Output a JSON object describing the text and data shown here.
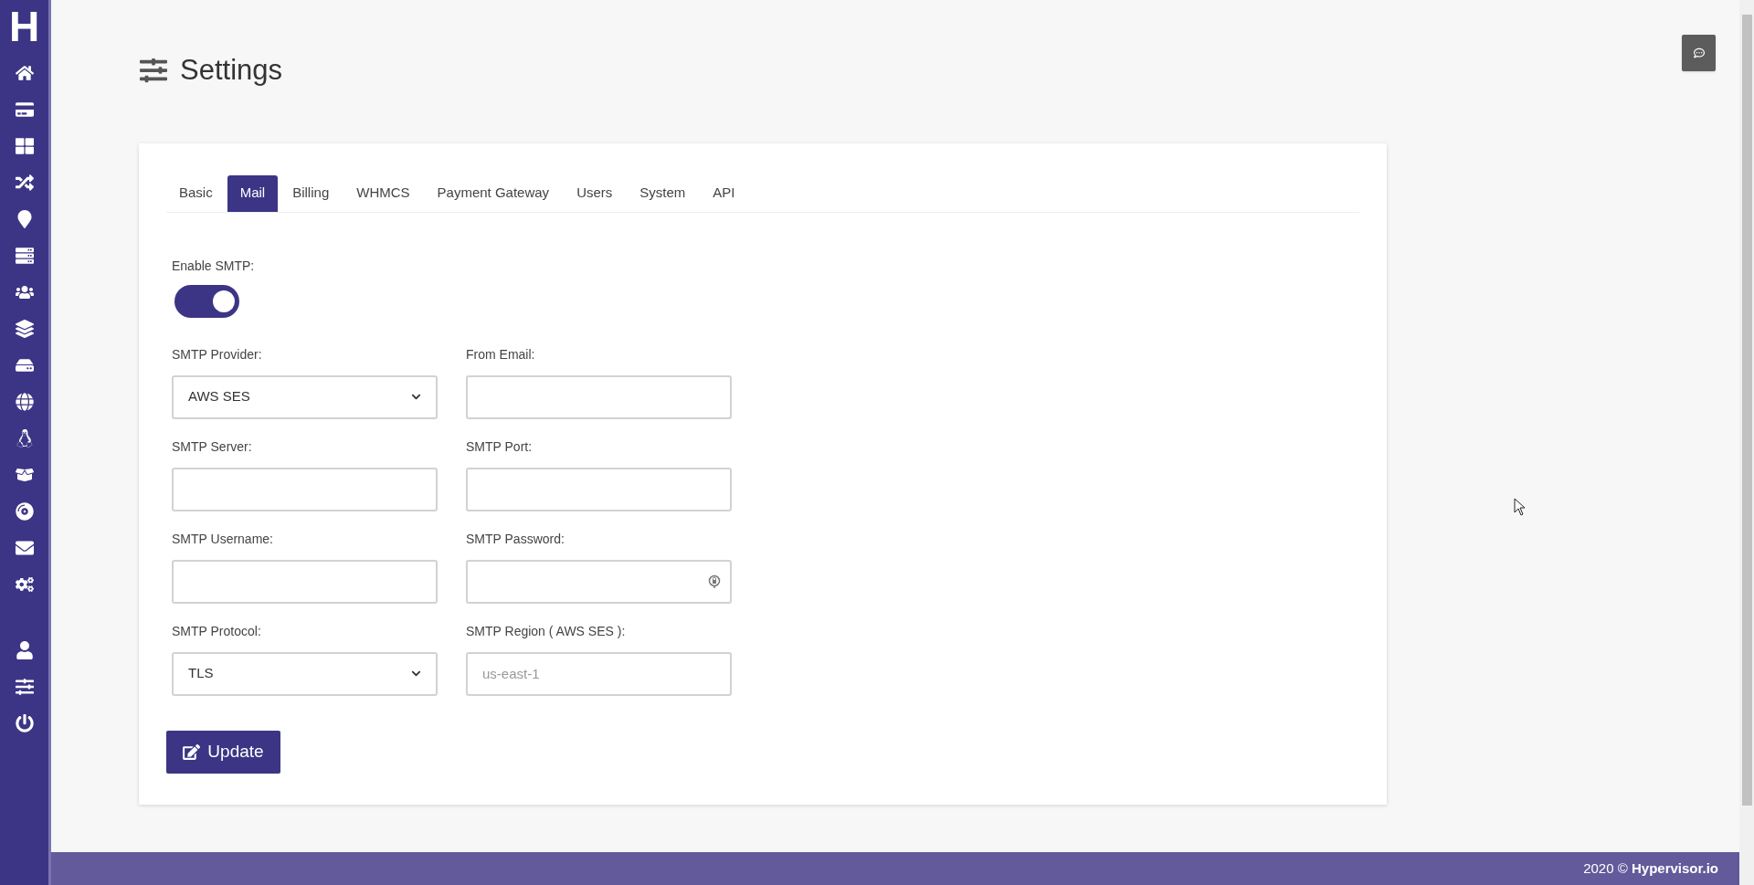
{
  "logo": "H",
  "page": {
    "title": "Settings"
  },
  "tabs": [
    {
      "label": "Basic",
      "selected": false
    },
    {
      "label": "Mail",
      "selected": true
    },
    {
      "label": "Billing",
      "selected": false
    },
    {
      "label": "WHMCS",
      "selected": false
    },
    {
      "label": "Payment Gateway",
      "selected": false
    },
    {
      "label": "Users",
      "selected": false
    },
    {
      "label": "System",
      "selected": false
    },
    {
      "label": "API",
      "selected": false
    }
  ],
  "enable_smtp": {
    "label": "Enable SMTP:",
    "on": true
  },
  "fields": [
    {
      "kind": "select",
      "label": "SMTP Provider:",
      "value": "AWS SES"
    },
    {
      "kind": "text",
      "label": "From Email:"
    },
    {
      "kind": "text",
      "label": "SMTP Server:"
    },
    {
      "kind": "text",
      "label": "SMTP Port:"
    },
    {
      "kind": "text",
      "label": "SMTP Username:"
    },
    {
      "kind": "password",
      "label": "SMTP Password:"
    },
    {
      "kind": "select",
      "label": "SMTP Protocol:",
      "value": "TLS"
    },
    {
      "kind": "text",
      "label": "SMTP Region ( AWS SES ):",
      "placeholder": "us-east-1"
    }
  ],
  "update_button": {
    "label": "Update"
  },
  "footer": {
    "text": "2020 © **Hypervisor.io**"
  }
}
